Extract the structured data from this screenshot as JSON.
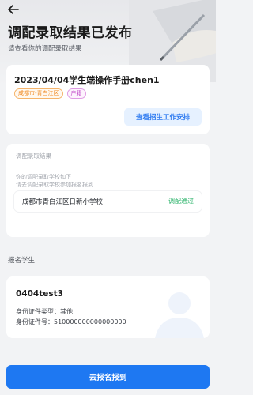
{
  "header": {
    "title": "调配录取结果已发布",
    "subtitle": "请查看你的调配录取结果"
  },
  "plan_card": {
    "title": "2023/04/04学生端操作手册chen1",
    "tags": [
      "成都市-青白江区",
      "户籍"
    ],
    "work_button_label": "查看招生工作安排"
  },
  "result_card": {
    "section_label": "调配录取结果",
    "description_line1": "你的调配录取学校如下",
    "description_line2": "请去调配录取学校参加报名报到",
    "school_name": "成都市青白江区日新小学校",
    "status": "调配通过"
  },
  "students": {
    "section_label": "报名学生",
    "name": "0404test3",
    "id_type_text": "身份证件类型：其他",
    "id_number_text": "身份证件号：510000000000000000"
  },
  "footer": {
    "primary_button_label": "去报名报到"
  },
  "colors": {
    "accent": "#1e78f2",
    "success": "#2bb36a",
    "tag_orange": "#f08a24",
    "tag_purple": "#c24cc9"
  }
}
